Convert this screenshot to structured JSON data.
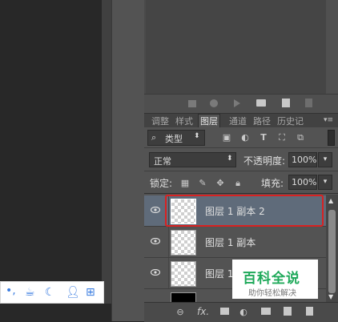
{
  "tabs": [
    {
      "label": "调整"
    },
    {
      "label": "样式"
    },
    {
      "label": "图层"
    },
    {
      "label": "通道"
    },
    {
      "label": "路径"
    },
    {
      "label": "历史记"
    }
  ],
  "filter": {
    "kind_label": "类型"
  },
  "blend": {
    "mode": "正常",
    "opacity_label": "不透明度:",
    "opacity_value": "100%"
  },
  "lock": {
    "label": "锁定:",
    "fill_label": "填充:",
    "fill_value": "100%"
  },
  "layers": [
    {
      "name": "图层 1 副本 2",
      "selected": true
    },
    {
      "name": "图层 1 副本",
      "selected": false
    },
    {
      "name": "图层 1",
      "selected": false
    }
  ],
  "watermark": {
    "title": "百科全说",
    "subtitle": "助你轻松解决"
  },
  "bottom_bar": {
    "fx_label": "fx."
  },
  "ime": {
    "punct": "•,"
  }
}
